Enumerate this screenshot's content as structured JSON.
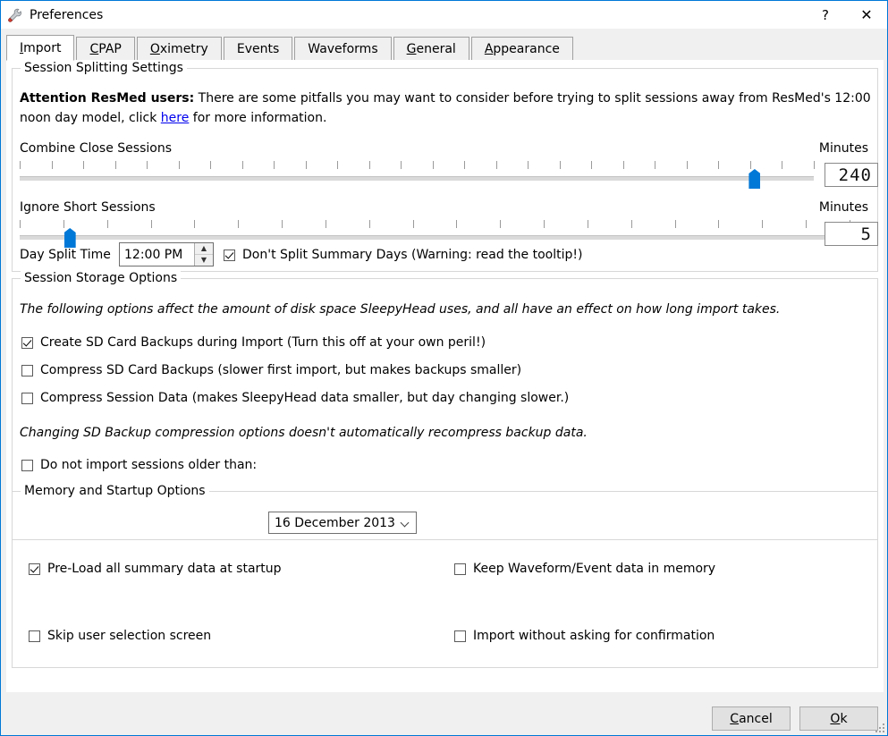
{
  "window": {
    "title": "Preferences",
    "icon": "wrench-icon",
    "help_label": "?",
    "close_label": "✕",
    "accent_color": "#0078d7"
  },
  "tabs": [
    {
      "label": "Import",
      "accel": "I",
      "active": true
    },
    {
      "label": "CPAP",
      "accel": "C",
      "active": false
    },
    {
      "label": "Oximetry",
      "accel": "O",
      "active": false
    },
    {
      "label": "Events",
      "accel": "",
      "active": false
    },
    {
      "label": "Waveforms",
      "accel": "",
      "active": false
    },
    {
      "label": "General",
      "accel": "G",
      "active": false
    },
    {
      "label": "Appearance",
      "accel": "A",
      "active": false
    }
  ],
  "session_splitting": {
    "title": "Session Splitting Settings",
    "attention": {
      "bold_prefix": "Attention ResMed users:",
      "text_before_link": " There are some pitfalls you may want to consider before trying to split sessions away from ResMed's 12:00 noon day model, click ",
      "link_text": "here",
      "text_after_link": " for more information."
    },
    "combine_close": {
      "label": "Combine Close Sessions",
      "units": "Minutes",
      "value": "240",
      "handle_percent": 92.5,
      "tick_count": 26
    },
    "ignore_short": {
      "label": "Ignore Short Sessions",
      "units": "Minutes",
      "value": "5",
      "handle_percent": 6.0,
      "tick_count": 20
    },
    "day_split": {
      "label": "Day Split Time",
      "value": "12:00 PM",
      "spin_up": "▲",
      "spin_down": "▼"
    },
    "dont_split": {
      "label": "Don't Split Summary Days (Warning: read the tooltip!)",
      "checked": true
    }
  },
  "session_storage": {
    "title": "Session Storage Options",
    "note_top": "The following options affect the amount of disk space SleepyHead uses, and all have an effect on how long import takes.",
    "note_mid": "Changing SD Backup compression options doesn't automatically recompress backup data.",
    "options": [
      {
        "label": "Create SD Card Backups during Import (Turn this off at your own peril!)",
        "checked": true
      },
      {
        "label": "Compress SD Card Backups (slower first import, but makes backups smaller)",
        "checked": false
      },
      {
        "label": "Compress Session Data (makes SleepyHead data smaller, but day changing slower.)",
        "checked": false
      }
    ],
    "date_limit": {
      "label": "Do not import sessions older than:",
      "checked": false,
      "selected_date": "16 December 2013"
    }
  },
  "memory_startup": {
    "title": "Memory and Startup Options",
    "options": [
      {
        "label": "Pre-Load all summary data at startup",
        "checked": true,
        "col": "left",
        "row": 0
      },
      {
        "label": "Keep Waveform/Event data in memory",
        "checked": false,
        "col": "right",
        "row": 0
      },
      {
        "label": "Skip user selection screen",
        "checked": false,
        "col": "left",
        "row": 1
      },
      {
        "label": "Import without asking for confirmation",
        "checked": false,
        "col": "right",
        "row": 1
      }
    ]
  },
  "buttons": {
    "cancel": {
      "pre": "",
      "accel": "C",
      "post": "ancel"
    },
    "ok": {
      "pre": "",
      "accel": "O",
      "post": "k"
    }
  }
}
